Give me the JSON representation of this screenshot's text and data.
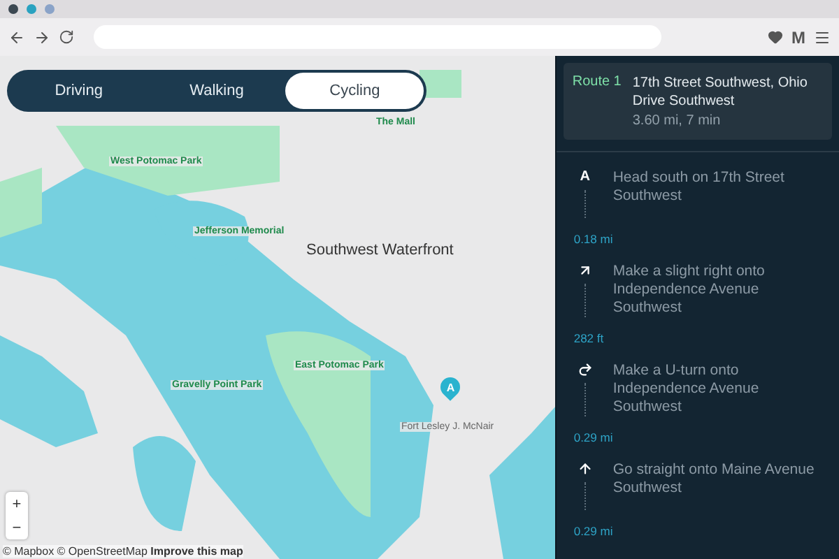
{
  "browser": {
    "profile_letter": "M"
  },
  "mode_tabs": [
    {
      "label": "Driving",
      "selected": false
    },
    {
      "label": "Walking",
      "selected": false
    },
    {
      "label": "Cycling",
      "selected": true
    }
  ],
  "map": {
    "labels": [
      {
        "text": "The Mall",
        "kind": "park"
      },
      {
        "text": "West Potomac Park",
        "kind": "park"
      },
      {
        "text": "Jefferson Memorial",
        "kind": "park"
      },
      {
        "text": "Southwest Waterfront",
        "kind": "district"
      },
      {
        "text": "East Potomac Park",
        "kind": "park"
      },
      {
        "text": "Gravelly Point Park",
        "kind": "park"
      },
      {
        "text": "Fort Lesley J. McNair",
        "kind": "place"
      }
    ],
    "marker": "A",
    "zoom_in": "+",
    "zoom_out": "−",
    "attribution": "© Mapbox © OpenStreetMap **Improve this map**"
  },
  "route": {
    "label": "Route 1",
    "title": "17th Street Southwest, Ohio Drive Southwest",
    "summary": "3.60 mi, 7 min"
  },
  "steps": [
    {
      "kind": "start",
      "marker": "A",
      "text": "Head south on 17th Street Southwest",
      "distance": "0.18 mi"
    },
    {
      "kind": "slight-right",
      "text": "Make a slight right onto Independence Avenue Southwest",
      "distance": "282 ft"
    },
    {
      "kind": "uturn",
      "text": "Make a U-turn onto Independence Avenue Southwest",
      "distance": "0.29 mi"
    },
    {
      "kind": "straight",
      "text": "Go straight onto Maine Avenue Southwest",
      "distance": "0.29 mi"
    }
  ]
}
